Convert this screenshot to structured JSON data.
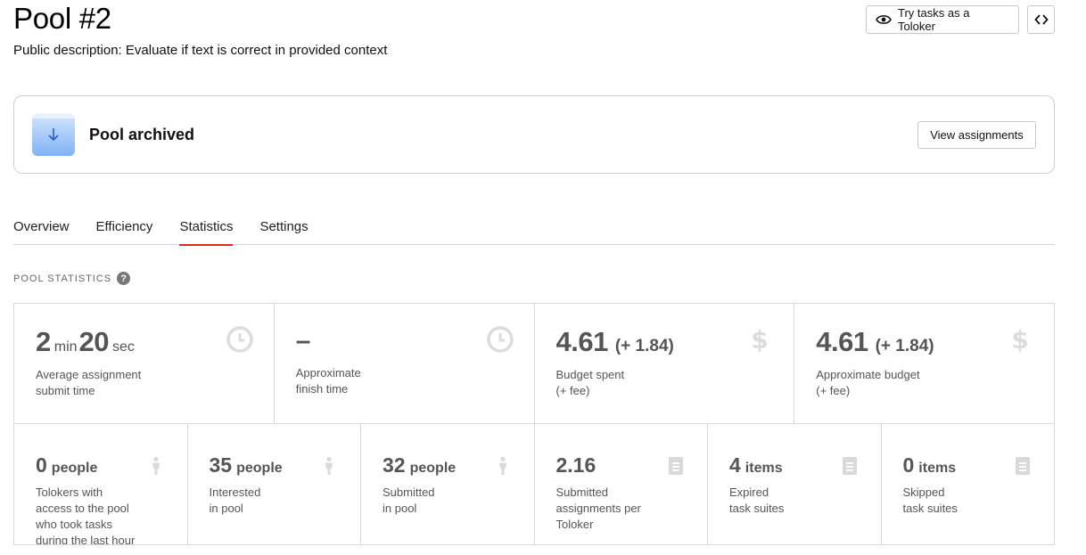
{
  "header": {
    "title": "Pool #2",
    "description": "Public description: Evaluate if text is correct in provided context",
    "try_tasks_label": "Try tasks as a Toloker"
  },
  "status_card": {
    "label": "Pool archived",
    "view_assignments_label": "View assignments"
  },
  "tabs": [
    {
      "label": "Overview"
    },
    {
      "label": "Efficiency"
    },
    {
      "label": "Statistics",
      "active": true
    },
    {
      "label": "Settings"
    }
  ],
  "section": {
    "label": "POOL STATISTICS",
    "help": "?"
  },
  "stats_top": [
    {
      "minutes": "2",
      "minutes_unit": "min",
      "seconds": "20",
      "seconds_unit": "sec",
      "label": "Average assignment\nsubmit time",
      "icon": "clock-icon"
    },
    {
      "value": "–",
      "label": "Approximate\nfinish time",
      "icon": "clock-icon"
    },
    {
      "value": "4.61",
      "extra": "(+ 1.84)",
      "label": "Budget spent\n(+ fee)",
      "icon": "dollar-icon"
    },
    {
      "value": "4.61",
      "extra": "(+ 1.84)",
      "label": "Approximate budget\n(+ fee)",
      "icon": "dollar-icon"
    }
  ],
  "stats_bottom": [
    {
      "value": "0",
      "unit": "people",
      "label": "Tolokers with\naccess to the pool\nwho took tasks\nduring the last hour",
      "icon": "person-icon"
    },
    {
      "value": "35",
      "unit": "people",
      "label": "Interested\nin pool",
      "icon": "person-icon"
    },
    {
      "value": "32",
      "unit": "people",
      "label": "Submitted\nin pool",
      "icon": "person-icon"
    },
    {
      "value": "2.16",
      "unit": "",
      "label": "Submitted\nassignments per\nToloker",
      "icon": "document-icon"
    },
    {
      "value": "4",
      "unit": "items",
      "label": "Expired\ntask suites",
      "icon": "document-icon"
    },
    {
      "value": "0",
      "unit": "items",
      "label": "Skipped\ntask suites",
      "icon": "document-icon"
    }
  ],
  "colors": {
    "accent_tab": "#e0281f",
    "archive_icon": "#7fb2f5",
    "icon_muted": "#d9d9d9"
  }
}
